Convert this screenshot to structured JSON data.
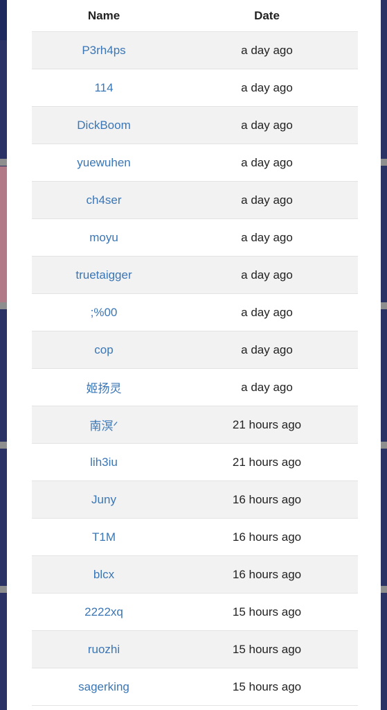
{
  "table": {
    "headers": {
      "name": "Name",
      "date": "Date"
    },
    "rows": [
      {
        "name": "P3rh4ps",
        "date": "a day ago"
      },
      {
        "name": "114",
        "date": "a day ago"
      },
      {
        "name": "DickBoom",
        "date": "a day ago"
      },
      {
        "name": "yuewuhen",
        "date": "a day ago"
      },
      {
        "name": "ch4ser",
        "date": "a day ago"
      },
      {
        "name": "moyu",
        "date": "a day ago"
      },
      {
        "name": "truetaigger",
        "date": "a day ago"
      },
      {
        "name": ";%00",
        "date": "a day ago"
      },
      {
        "name": "cop",
        "date": "a day ago"
      },
      {
        "name": "姬扬灵",
        "date": "a day ago"
      },
      {
        "name": "南溟ᐟ",
        "date": "21 hours ago"
      },
      {
        "name": "lih3iu",
        "date": "21 hours ago"
      },
      {
        "name": "Juny",
        "date": "16 hours ago"
      },
      {
        "name": "T1M",
        "date": "16 hours ago"
      },
      {
        "name": "blcx",
        "date": "16 hours ago"
      },
      {
        "name": "2222xq",
        "date": "15 hours ago"
      },
      {
        "name": "ruozhi",
        "date": "15 hours ago"
      },
      {
        "name": "sagerking",
        "date": "15 hours ago"
      }
    ]
  },
  "colors": {
    "link": "#3a76b5",
    "row_stripe": "#f2f2f2",
    "backdrop": "#2a3363"
  }
}
